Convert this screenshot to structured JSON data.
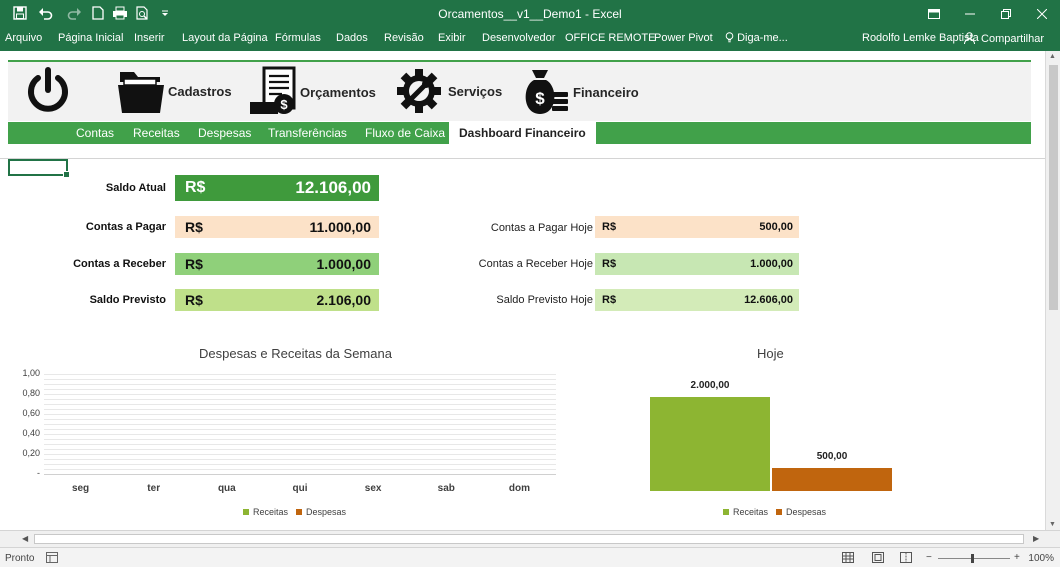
{
  "titlebar": {
    "title": "Orcamentos__v1__Demo1 - Excel",
    "qa_icons": [
      "save-icon",
      "undo-icon",
      "redo-icon",
      "new-icon",
      "print-icon",
      "preview-icon",
      "customize-icon"
    ],
    "color": "#217346"
  },
  "ribbon": {
    "tabs": [
      "Arquivo",
      "Página Inicial",
      "Inserir",
      "Layout da Página",
      "Fórmulas",
      "Dados",
      "Revisão",
      "Exibir",
      "Desenvolvedor",
      "OFFICE REMOTE",
      "Power Pivot",
      "Diga-me..."
    ],
    "user": "Rodolfo Lemke Baptista",
    "share": "Compartilhar"
  },
  "menu": {
    "items": [
      {
        "label": "",
        "icon": "power-icon"
      },
      {
        "label": "Cadastros",
        "icon": "folder-icon"
      },
      {
        "label": "Orçamentos",
        "icon": "invoice-icon"
      },
      {
        "label": "Serviços",
        "icon": "gear-wrench-icon"
      },
      {
        "label": "Financeiro",
        "icon": "money-bag-icon"
      }
    ]
  },
  "subnav": {
    "items": [
      "Contas",
      "Receitas",
      "Despesas",
      "Transferências",
      "Fluxo de Caixa",
      "Dashboard Financeiro"
    ],
    "active": "Dashboard Financeiro"
  },
  "kpis": {
    "currency": "R$",
    "saldo_atual": {
      "label": "Saldo Atual",
      "value": "12.106,00",
      "color": "#3f9a3c"
    },
    "left": [
      {
        "label": "Contas a Pagar",
        "value": "11.000,00",
        "color": "#fce2c8"
      },
      {
        "label": "Contas  a Receber",
        "value": "1.000,00",
        "color": "#8fd07a"
      },
      {
        "label": "Saldo Previsto",
        "value": "2.106,00",
        "color": "#bfe08a"
      }
    ],
    "right": [
      {
        "label": "Contas a Pagar Hoje",
        "value": "500,00",
        "color": "#fce2c8"
      },
      {
        "label": "Contas a Receber Hoje",
        "value": "1.000,00",
        "color": "#c7e7b3"
      },
      {
        "label": "Saldo Previsto Hoje",
        "value": "12.606,00",
        "color": "#d3ebb8"
      }
    ]
  },
  "chart_data": [
    {
      "type": "bar",
      "title": "Despesas e Receitas da Semana",
      "categories": [
        "seg",
        "ter",
        "qua",
        "qui",
        "sex",
        "sab",
        "dom"
      ],
      "yticks": [
        "1,00",
        "0,80",
        "0,60",
        "0,40",
        "0,20",
        "-"
      ],
      "ylim": [
        0,
        1
      ],
      "series": [
        {
          "name": "Receitas",
          "values": [
            0,
            0,
            0,
            0,
            0,
            0,
            0
          ],
          "color": "#8db532"
        },
        {
          "name": "Despesas",
          "values": [
            0,
            0,
            0,
            0,
            0,
            0,
            0
          ],
          "color": "#c0650e"
        }
      ],
      "grid": true,
      "legend": "bottom"
    },
    {
      "type": "bar",
      "title": "Hoje",
      "categories": [
        "Receitas",
        "Despesas"
      ],
      "values": [
        2000,
        500
      ],
      "value_labels": [
        "2.000,00",
        "500,00"
      ],
      "colors": [
        "#8db532",
        "#c0650e"
      ],
      "legend": "bottom"
    }
  ],
  "statusbar": {
    "status": "Pronto",
    "zoom": "100%"
  }
}
